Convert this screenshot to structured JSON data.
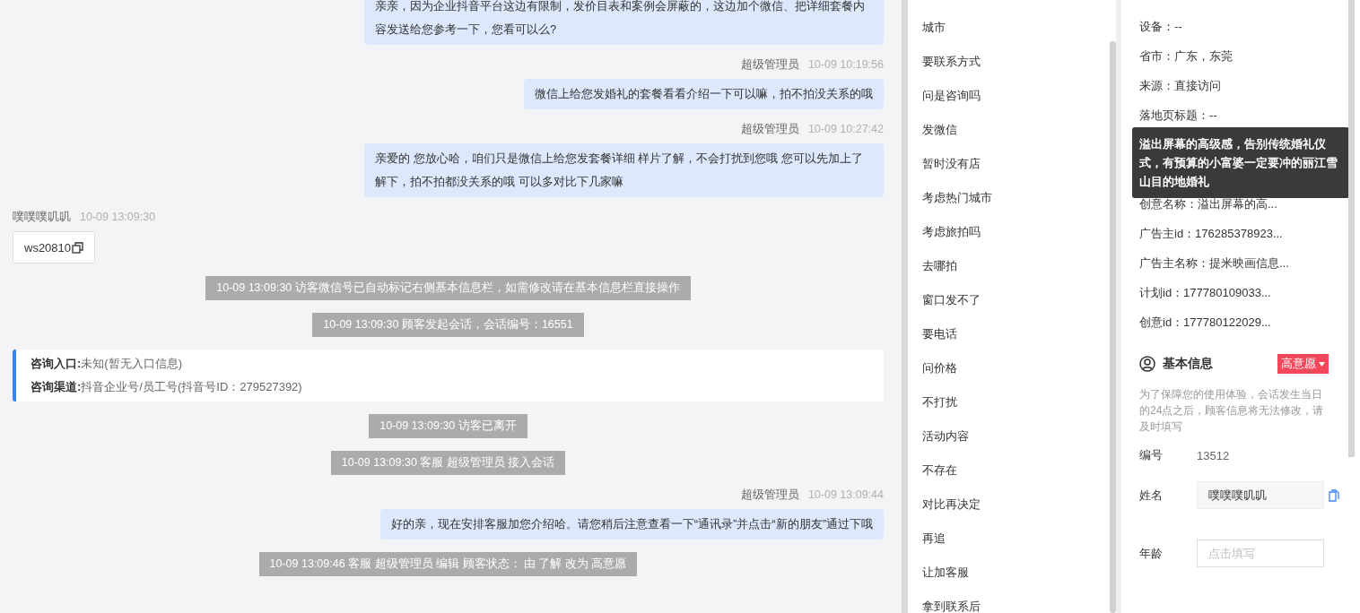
{
  "chat": [
    {
      "kind": "agent",
      "text": "亲亲，因为企业抖音平台这边有限制，发价目表和案例会屏蔽的，这边加个微信、把详细套餐内容发送给您参考一下，您看可以么?"
    },
    {
      "kind": "agent",
      "sender": "超级管理员",
      "time": "10-09 10:19:56",
      "text": "微信上给您发婚礼的套餐看看介绍一下可以嘛，拍不拍没关系的哦"
    },
    {
      "kind": "agent",
      "sender": "超级管理员",
      "time": "10-09 10:27:42",
      "text": "亲爱的 您放心哈，咱们只是微信上给您发套餐详细 样片了解，不会打扰到您哦 您可以先加上了解下，拍不拍都没关系的哦 可以多对比下几家嘛"
    },
    {
      "kind": "visitor",
      "sender": "噗噗噗叽叽",
      "time": "10-09 13:09:30",
      "text": "ws20810"
    },
    {
      "kind": "system",
      "text": "10-09 13:09:30 访客微信号已自动标记右侧基本信息栏，如需修改请在基本信息栏直接操作"
    },
    {
      "kind": "system",
      "text": "10-09 13:09:30 顾客发起会话，会话编号：16551"
    },
    {
      "kind": "info",
      "lines": [
        {
          "label": "咨询入口:",
          "value": "未知(暂无入口信息)"
        },
        {
          "label": "咨询渠道:",
          "value": "抖音企业号/员工号(抖音号ID：279527392)"
        }
      ]
    },
    {
      "kind": "system",
      "text": "10-09 13:09:30 访客已离开"
    },
    {
      "kind": "system",
      "text": "10-09 13:09:30 客服 超级管理员 接入会话"
    },
    {
      "kind": "agent",
      "sender": "超级管理员",
      "time": "10-09 13:09:44",
      "text": "好的亲，现在安排客服加您介绍哈。请您稍后注意查看一下“通讯录”并点击“新的朋友”通过下哦"
    },
    {
      "kind": "system",
      "text": "10-09 13:09:46 客服 超级管理员 编辑 顾客状态： 由 了解 改为 高意愿"
    }
  ],
  "tags": [
    "城市",
    "要联系方式",
    "问是咨询吗",
    "发微信",
    "暂时没有店",
    "考虑热门城市",
    "考虑旅拍吗",
    "去哪拍",
    "窗口发不了",
    "要电话",
    "问价格",
    "不打扰",
    "活动内容",
    "不存在",
    "对比再决定",
    "再追",
    "让加客服",
    "拿到联系后"
  ],
  "details": {
    "rows_top": [
      "设备：--",
      "省市：广东，东莞",
      "来源：直接访问",
      "落地页标题：--"
    ],
    "tooltip": "溢出屏幕的高级感，告别传统婚礼仪式，有预算的小富婆一定要冲的丽江雪山目的地婚礼",
    "rows_bottom": [
      "创意名称：溢出屏幕的高...",
      "广告主id：176285378923...",
      "广告主名称：提米映画信息...",
      "计划id：177780109033...",
      "创意id：177780122029..."
    ]
  },
  "basic_info": {
    "title": "基本信息",
    "status": "高意愿",
    "note": "为了保障您的使用体验，会话发生当日的24点之后，顾客信息将无法修改，请及时填写",
    "fields": [
      {
        "kind": "text",
        "label": "编号",
        "value": "13512"
      },
      {
        "kind": "filled",
        "label": "姓名",
        "value": "噗噗噗叽叽"
      },
      {
        "kind": "input",
        "label": "年龄",
        "placeholder": "点击填写"
      }
    ]
  }
}
